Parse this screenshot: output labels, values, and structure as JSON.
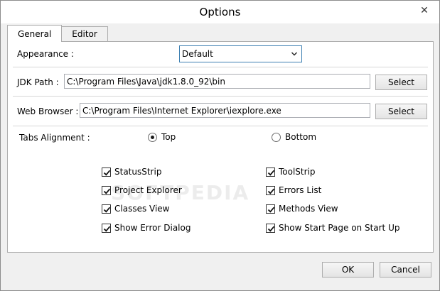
{
  "window": {
    "title": "Options",
    "close_glyph": "✕"
  },
  "tabs": [
    {
      "label": "General",
      "active": true
    },
    {
      "label": "Editor",
      "active": false
    }
  ],
  "appearance": {
    "label": "Appearance :",
    "value": "Default"
  },
  "jdk": {
    "label": "JDK Path :",
    "value": "C:\\Program Files\\Java\\jdk1.8.0_92\\bin",
    "button": "Select"
  },
  "browser": {
    "label": "Web Browser :",
    "value": "C:\\Program Files\\Internet Explorer\\iexplore.exe",
    "button": "Select"
  },
  "tabs_alignment": {
    "label": "Tabs Alignment :",
    "options": [
      {
        "label": "Top",
        "selected": true
      },
      {
        "label": "Bottom",
        "selected": false
      }
    ]
  },
  "checks_left": [
    {
      "label": "StatusStrip",
      "checked": true
    },
    {
      "label": "Project Explorer",
      "checked": true
    },
    {
      "label": "Classes View",
      "checked": true
    },
    {
      "label": "Show Error Dialog",
      "checked": true
    }
  ],
  "checks_right": [
    {
      "label": "ToolStrip",
      "checked": true
    },
    {
      "label": "Errors List",
      "checked": true
    },
    {
      "label": "Methods View",
      "checked": true
    },
    {
      "label": "Show Start Page on Start Up",
      "checked": true
    }
  ],
  "watermark": "SOFTPEDIA",
  "footer": {
    "ok": "OK",
    "cancel": "Cancel"
  }
}
